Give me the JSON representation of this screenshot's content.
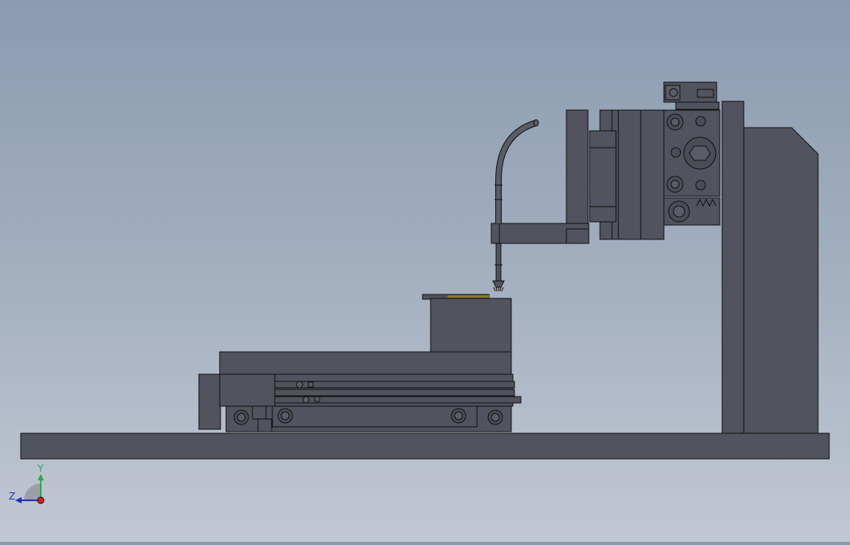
{
  "viewport": {
    "background_top": "#8b9bb0",
    "background_bottom": "#c2c8d3",
    "part_color": "#51545e",
    "edge_color": "#111111"
  },
  "triad": {
    "y_label": "Y",
    "z_label": "Z",
    "y_color": "#2fa84f",
    "z_color": "#1f2fbf",
    "x_color": "#d22020"
  }
}
